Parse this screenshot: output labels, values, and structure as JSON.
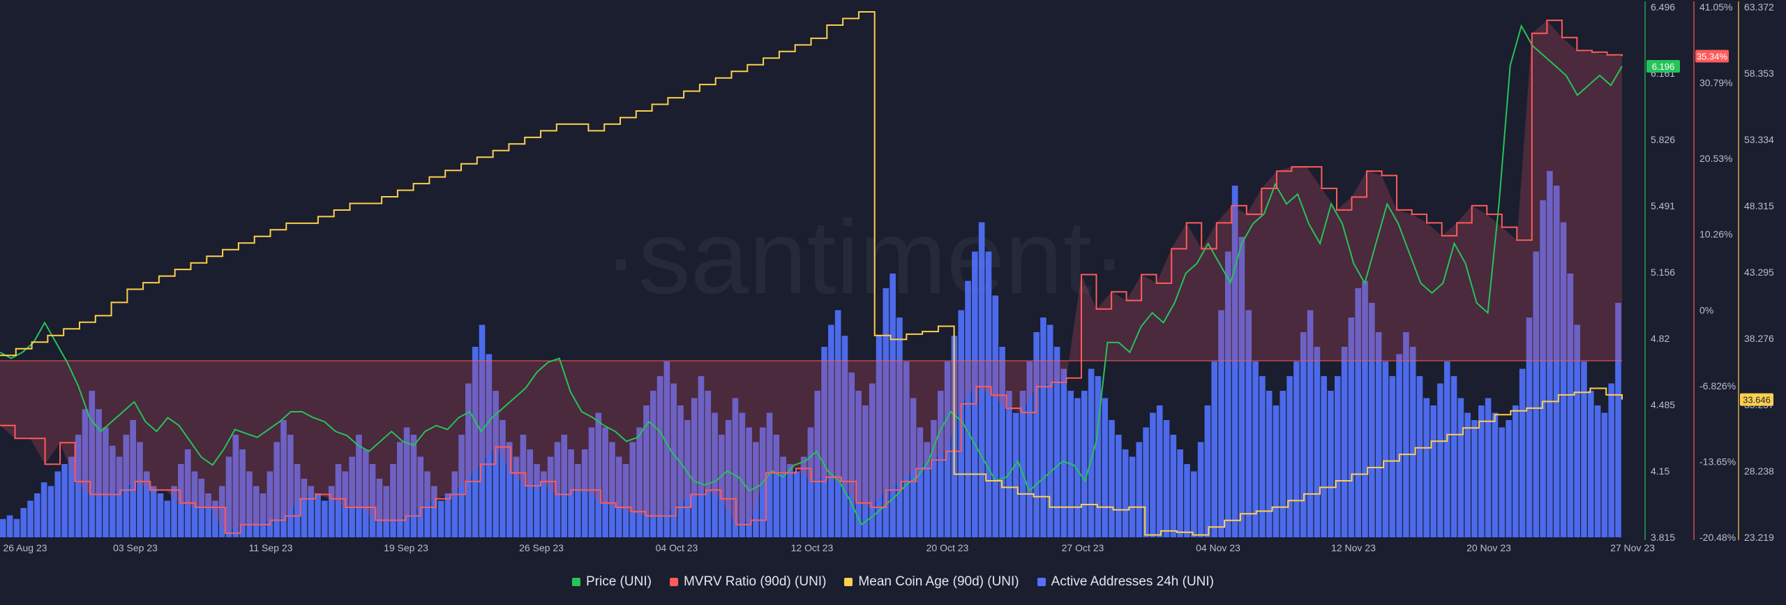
{
  "watermark": "·santiment·",
  "colors": {
    "background": "#1a1e2e",
    "price": "#26c35b",
    "mvrv": "#ff5b5b",
    "mean_coin_age": "#ffd04f",
    "active_addresses": "#5272ff",
    "mvrv_fill_positive": "#5a2d3d",
    "mvrv_fill_negative": "#4a2a3c"
  },
  "legend": [
    {
      "label": "Price (UNI)",
      "color": "#26c35b"
    },
    {
      "label": "MVRV Ratio (90d) (UNI)",
      "color": "#ff5b5b"
    },
    {
      "label": "Mean Coin Age (90d) (UNI)",
      "color": "#ffd04f"
    },
    {
      "label": "Active Addresses 24h (UNI)",
      "color": "#5272ff"
    }
  ],
  "chart_data": {
    "type": "line",
    "x_axis": {
      "range": [
        "26 Aug 23",
        "27 Nov 23"
      ],
      "tick_labels": [
        "26 Aug 23",
        "03 Sep 23",
        "11 Sep 23",
        "19 Sep 23",
        "26 Sep 23",
        "04 Oct 23",
        "12 Oct 23",
        "20 Oct 23",
        "27 Oct 23",
        "04 Nov 23",
        "12 Nov 23",
        "20 Nov 23",
        "27 Nov 23"
      ]
    },
    "axes": {
      "price": {
        "ylim": [
          3.815,
          6.496
        ],
        "ticks": [
          "6.496",
          "6.161",
          "5.826",
          "5.491",
          "5.156",
          "4.82",
          "4.485",
          "4.15",
          "3.815"
        ],
        "color": "#26c35b",
        "current_label": "6.196"
      },
      "mvrv": {
        "ylim": [
          -20.48,
          41.05
        ],
        "ticks": [
          "41.05%",
          "30.79%",
          "20.53%",
          "10.26%",
          "0%",
          "-6.826%",
          "-13.65%",
          "-20.48%"
        ],
        "color": "#ff5b5b",
        "current_label": "35.34%"
      },
      "mean_coin_age": {
        "ylim": [
          23.219,
          63.372
        ],
        "ticks": [
          "63.372",
          "58.353",
          "53.334",
          "48.315",
          "43.295",
          "38.276",
          "33.257",
          "28.238",
          "23.219"
        ],
        "color": "#ffd04f",
        "current_label": "33.646"
      },
      "active_addresses": {
        "ylim": [
          0,
          1
        ],
        "ticks": [],
        "color": "#5272ff"
      }
    },
    "series": [
      {
        "name": "Price (UNI)",
        "axis": "price",
        "values": [
          4.75,
          4.72,
          4.75,
          4.8,
          4.9,
          4.8,
          4.7,
          4.58,
          4.42,
          4.35,
          4.4,
          4.45,
          4.5,
          4.4,
          4.35,
          4.42,
          4.38,
          4.3,
          4.22,
          4.18,
          4.26,
          4.36,
          4.34,
          4.32,
          4.36,
          4.4,
          4.45,
          4.45,
          4.42,
          4.4,
          4.35,
          4.33,
          4.28,
          4.25,
          4.3,
          4.35,
          4.3,
          4.28,
          4.35,
          4.38,
          4.36,
          4.42,
          4.45,
          4.35,
          4.42,
          4.47,
          4.52,
          4.57,
          4.65,
          4.7,
          4.72,
          4.55,
          4.45,
          4.42,
          4.38,
          4.35,
          4.3,
          4.32,
          4.4,
          4.35,
          4.25,
          4.18,
          4.1,
          4.08,
          4.1,
          4.15,
          4.12,
          4.05,
          4.08,
          4.15,
          4.12,
          4.18,
          4.2,
          4.25,
          4.15,
          4.1,
          4.0,
          3.88,
          3.92,
          3.97,
          4.02,
          4.08,
          4.12,
          4.2,
          4.35,
          4.45,
          4.4,
          4.3,
          4.2,
          4.1,
          4.12,
          4.2,
          4.05,
          4.1,
          4.15,
          4.2,
          4.18,
          4.1,
          4.3,
          4.8,
          4.8,
          4.75,
          4.88,
          4.95,
          4.9,
          5.0,
          5.15,
          5.2,
          5.3,
          5.2,
          5.1,
          5.3,
          5.4,
          5.45,
          5.6,
          5.5,
          5.55,
          5.4,
          5.3,
          5.5,
          5.4,
          5.2,
          5.1,
          5.3,
          5.5,
          5.4,
          5.25,
          5.1,
          5.05,
          5.1,
          5.3,
          5.2,
          5.0,
          4.95,
          5.5,
          6.2,
          6.4,
          6.3,
          6.25,
          6.2,
          6.15,
          6.05,
          6.1,
          6.15,
          6.1,
          6.196
        ]
      },
      {
        "name": "MVRV Ratio (90d) (UNI)",
        "axis": "mvrv",
        "values": [
          -7.5,
          -9.0,
          -9.0,
          -12.0,
          -9.5,
          -14.0,
          -15.5,
          -15.5,
          -15.0,
          -14.0,
          -15.0,
          -15.0,
          -16.5,
          -17.0,
          -17.0,
          -20.0,
          -19.0,
          -19.0,
          -18.5,
          -18.0,
          -16.0,
          -15.5,
          -16.0,
          -17.0,
          -17.0,
          -18.5,
          -18.5,
          -18.0,
          -17.0,
          -16.0,
          -15.5,
          -14.0,
          -12.0,
          -10.0,
          -13.0,
          -14.5,
          -14.0,
          -15.5,
          -15.0,
          -15.0,
          -16.5,
          -17.0,
          -17.5,
          -18.0,
          -18.0,
          -17.0,
          -15.5,
          -15.0,
          -16.0,
          -19.0,
          -18.5,
          -13.0,
          -13.0,
          -12.5,
          -14.0,
          -13.5,
          -14.0,
          -16.5,
          -17.0,
          -15.0,
          -14.0,
          -12.5,
          -11.5,
          -10.5,
          -5.0,
          -3.0,
          -4.0,
          -5.5,
          -6.0,
          -3.0,
          -2.5,
          -2.0,
          10.0,
          6.0,
          8.0,
          7.0,
          10.0,
          9.0,
          13.0,
          16.0,
          13.0,
          16.0,
          18.0,
          17.0,
          20.0,
          22.0,
          22.5,
          22.5,
          20.0,
          17.5,
          19.0,
          22.0,
          21.5,
          17.5,
          17.0,
          16.0,
          14.5,
          16.0,
          18.0,
          17.0,
          15.5,
          14.0,
          38.0,
          39.5,
          37.5,
          36.0,
          35.8,
          35.5,
          35.34
        ]
      },
      {
        "name": "Mean Coin Age (90d) (UNI)",
        "axis": "mean_coin_age",
        "values": [
          37.0,
          37.5,
          38.0,
          38.5,
          39.0,
          39.5,
          40.0,
          41.0,
          42.0,
          42.5,
          43.0,
          43.5,
          44.0,
          44.5,
          45.0,
          45.5,
          46.0,
          46.5,
          47.0,
          47.0,
          47.5,
          48.0,
          48.5,
          48.5,
          49.0,
          49.5,
          50.0,
          50.5,
          51.0,
          51.5,
          52.0,
          52.5,
          53.0,
          53.5,
          54.0,
          54.5,
          54.5,
          54.0,
          54.5,
          55.0,
          55.5,
          56.0,
          56.5,
          57.0,
          57.5,
          58.0,
          58.5,
          59.0,
          59.5,
          60.0,
          60.5,
          61.0,
          62.0,
          62.5,
          63.0,
          38.5,
          38.2,
          38.6,
          38.8,
          39.2,
          28.0,
          28.0,
          27.5,
          27.0,
          26.5,
          26.3,
          25.5,
          25.5,
          25.7,
          25.5,
          25.3,
          25.5,
          23.4,
          23.7,
          23.6,
          23.4,
          24.0,
          24.5,
          25.0,
          25.2,
          25.5,
          26.0,
          26.5,
          27.0,
          27.5,
          28.0,
          28.5,
          29.0,
          29.5,
          30.0,
          30.5,
          31.0,
          31.5,
          32.0,
          32.5,
          32.8,
          33.0,
          33.5,
          34.0,
          34.2,
          34.5,
          34.0,
          33.646
        ]
      },
      {
        "name": "Active Addresses 24h (UNI)",
        "axis": "active_addresses",
        "type": "bar",
        "values": [
          0.05,
          0.06,
          0.05,
          0.08,
          0.1,
          0.12,
          0.15,
          0.14,
          0.18,
          0.2,
          0.22,
          0.28,
          0.35,
          0.4,
          0.35,
          0.3,
          0.25,
          0.22,
          0.28,
          0.32,
          0.26,
          0.18,
          0.14,
          0.12,
          0.1,
          0.14,
          0.2,
          0.24,
          0.18,
          0.16,
          0.12,
          0.1,
          0.14,
          0.22,
          0.28,
          0.24,
          0.18,
          0.14,
          0.12,
          0.18,
          0.26,
          0.32,
          0.28,
          0.2,
          0.16,
          0.14,
          0.12,
          0.1,
          0.14,
          0.2,
          0.18,
          0.22,
          0.28,
          0.24,
          0.2,
          0.16,
          0.14,
          0.2,
          0.26,
          0.3,
          0.28,
          0.22,
          0.18,
          0.14,
          0.1,
          0.12,
          0.18,
          0.28,
          0.42,
          0.52,
          0.58,
          0.5,
          0.4,
          0.32,
          0.26,
          0.22,
          0.28,
          0.24,
          0.2,
          0.18,
          0.22,
          0.26,
          0.28,
          0.24,
          0.2,
          0.24,
          0.3,
          0.34,
          0.3,
          0.26,
          0.22,
          0.2,
          0.26,
          0.3,
          0.36,
          0.4,
          0.44,
          0.48,
          0.42,
          0.36,
          0.32,
          0.38,
          0.44,
          0.4,
          0.34,
          0.28,
          0.32,
          0.38,
          0.34,
          0.3,
          0.26,
          0.3,
          0.34,
          0.28,
          0.22,
          0.2,
          0.18,
          0.22,
          0.3,
          0.4,
          0.52,
          0.58,
          0.62,
          0.55,
          0.45,
          0.4,
          0.36,
          0.42,
          0.55,
          0.68,
          0.72,
          0.6,
          0.48,
          0.38,
          0.3,
          0.26,
          0.32,
          0.4,
          0.48,
          0.55,
          0.62,
          0.7,
          0.78,
          0.86,
          0.78,
          0.66,
          0.52,
          0.4,
          0.34,
          0.4,
          0.48,
          0.56,
          0.6,
          0.58,
          0.52,
          0.46,
          0.4,
          0.38,
          0.4,
          0.46,
          0.44,
          0.38,
          0.32,
          0.28,
          0.24,
          0.22,
          0.26,
          0.3,
          0.34,
          0.36,
          0.32,
          0.28,
          0.24,
          0.2,
          0.18,
          0.26,
          0.36,
          0.48,
          0.62,
          0.78,
          0.96,
          0.82,
          0.62,
          0.48,
          0.44,
          0.4,
          0.36,
          0.4,
          0.44,
          0.48,
          0.56,
          0.62,
          0.52,
          0.44,
          0.4,
          0.44,
          0.52,
          0.6,
          0.68,
          0.7,
          0.64,
          0.56,
          0.48,
          0.44,
          0.5,
          0.56,
          0.52,
          0.44,
          0.38,
          0.36,
          0.42,
          0.48,
          0.44,
          0.38,
          0.34,
          0.32,
          0.36,
          0.38,
          0.34,
          0.3,
          0.32,
          0.36,
          0.46,
          0.6,
          0.78,
          0.92,
          1.0,
          0.96,
          0.86,
          0.72,
          0.58,
          0.48,
          0.4,
          0.36,
          0.34,
          0.42,
          0.64
        ]
      }
    ]
  }
}
